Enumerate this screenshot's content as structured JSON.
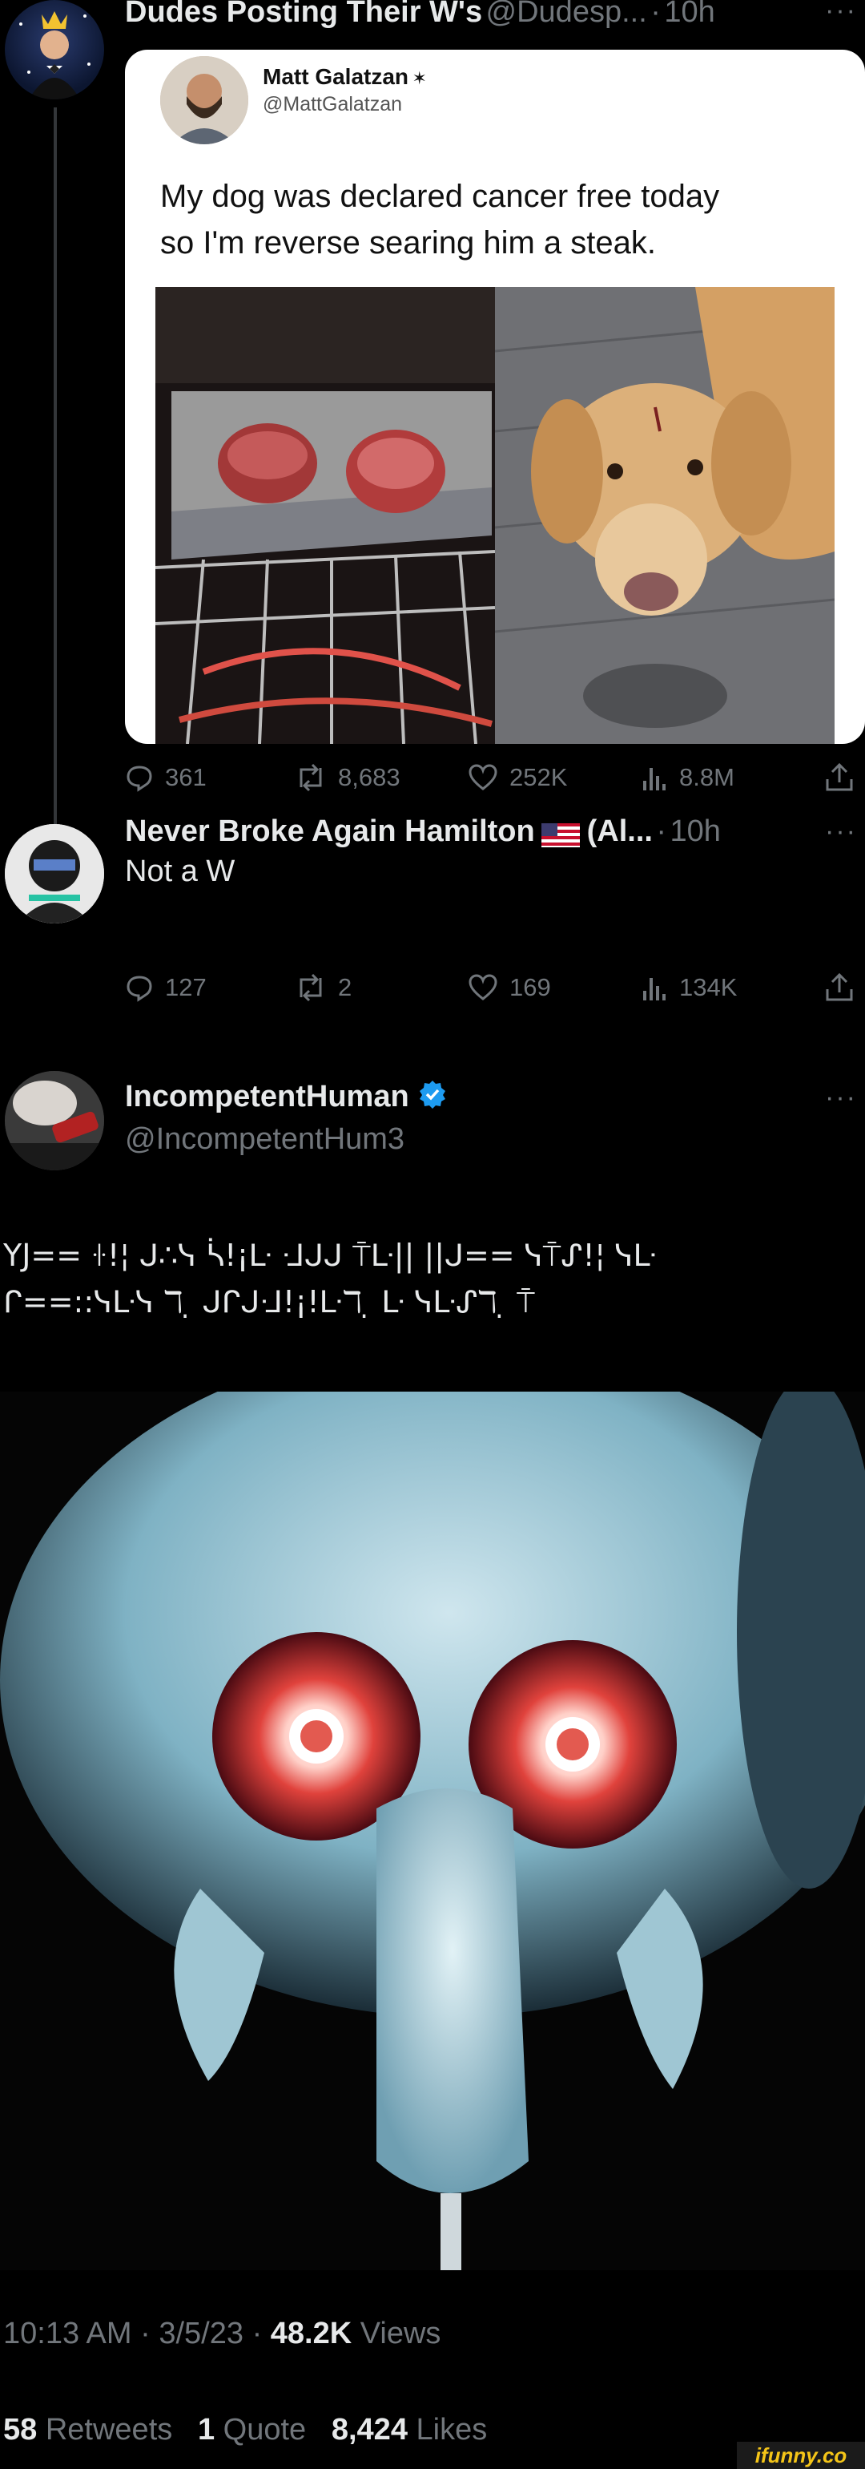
{
  "tweet1": {
    "author_name": "Dudes Posting Their W's",
    "author_handle": "@Dudesp...",
    "time": "10h",
    "embedded": {
      "name": "Matt Galatzan",
      "handle": "@MattGalatzan",
      "text_line1": "My dog was declared cancer free today",
      "text_line2": "so I'm reverse searing him a steak."
    },
    "actions": {
      "replies": "361",
      "retweets": "8,683",
      "likes": "252K",
      "views": "8.8M"
    }
  },
  "tweet2": {
    "author_name": "Never Broke Again Hamilton",
    "author_suffix": "(Al...",
    "time": "10h",
    "text": "Not a W",
    "actions": {
      "replies": "127",
      "retweets": "2",
      "likes": "169",
      "views": "134K"
    }
  },
  "tweet3": {
    "author_name": "IncompetentHuman",
    "author_handle": "@IncompetentHum3",
    "text_line1": "YJ== ꖌ!¦ ᒍ∴ᓭ ᓵ!¡ᒷ ᒲᒍᒍ ⍑ᒷ|| ||ᒍ== ᓭ⍑ᔑ!¦ ᓭᒷ",
    "text_line2": "ᒋ==::ᓭᒷᓭ ℸ ̣ ᒍᒋᒍᒲ!¡!ᒷℸ ̣ ᒷ ᓭᒷᔑℸ ̣ ⍑",
    "time": "10:13 AM",
    "date": "3/5/23",
    "views_count": "48.2K",
    "views_label": "Views",
    "retweets_count": "58",
    "retweets_label": "Retweets",
    "quotes_count": "1",
    "quotes_label": "Quote",
    "likes_count": "8,424",
    "likes_label": "Likes"
  },
  "watermark": "ifunny.co",
  "separator": "·",
  "colors": {
    "accent": "#1d9bf0",
    "muted": "#71767b",
    "text": "#e7e9ea",
    "watermark": "#f5c518"
  }
}
